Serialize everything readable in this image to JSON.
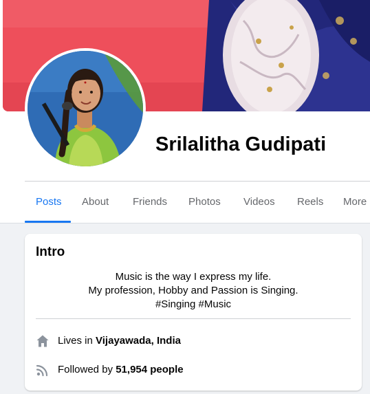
{
  "profile": {
    "name": "Srilalitha Gudipati"
  },
  "tabs": [
    {
      "label": "Posts",
      "active": true
    },
    {
      "label": "About",
      "active": false
    },
    {
      "label": "Friends",
      "active": false
    },
    {
      "label": "Photos",
      "active": false
    },
    {
      "label": "Videos",
      "active": false
    },
    {
      "label": "Reels",
      "active": false
    },
    {
      "label": "More",
      "active": false
    }
  ],
  "intro": {
    "title": "Intro",
    "bio": {
      "line1": "Music is the way I express my life.",
      "line2": "My profession, Hobby and Passion is Singing.",
      "line3": "#Singing #Music"
    },
    "lives": {
      "prefix": "Lives in ",
      "place": "Vijayawada, India",
      "icon": "home-icon"
    },
    "followers": {
      "prefix": "Followed by ",
      "count": "51,954 people",
      "icon": "rss-icon"
    }
  },
  "colors": {
    "accent": "#1877f2",
    "text_primary": "#050505",
    "text_secondary": "#65676b",
    "page_background": "#f0f2f5"
  }
}
